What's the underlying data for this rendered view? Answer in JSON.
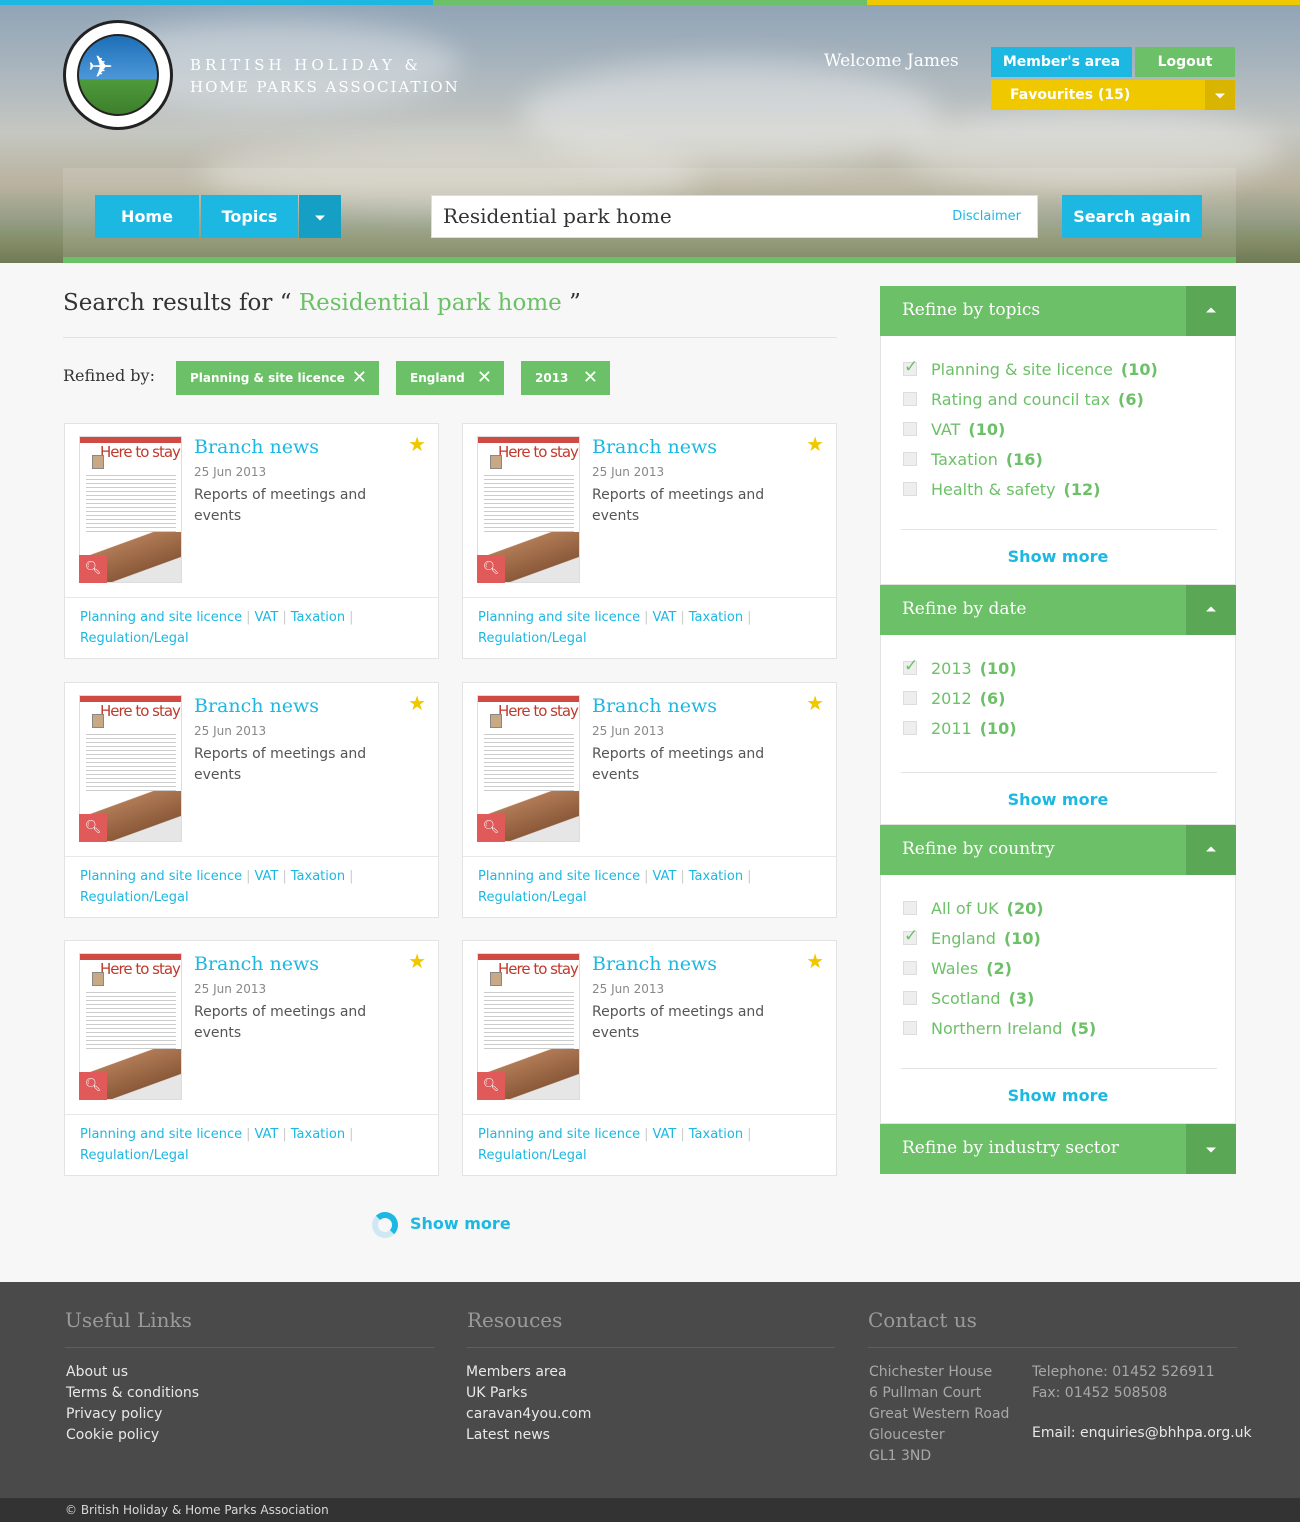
{
  "colors": {
    "blue": "#1cb8e2",
    "green": "#6cc067",
    "yellow": "#f0c800",
    "red": "#e05a5a",
    "footer": "#4a4a4a"
  },
  "header": {
    "brand_line1": "BRITISH HOLIDAY &",
    "brand_line2": "HOME PARKS ASSOCIATION",
    "logo_text": "BRITISH HOLIDAY & HOME PARKS ASSOCIATION",
    "welcome": "Welcome James",
    "members_area": "Member's area",
    "logout": "Logout",
    "favourites": "Favourites (15)"
  },
  "nav": {
    "home": "Home",
    "topics": "Topics",
    "search_value": "Residential park home",
    "disclaimer": "Disclaimer",
    "search_again": "Search again"
  },
  "results": {
    "title_prefix": "Search results for",
    "open_quote": "“",
    "query": "Residential park home",
    "close_quote": "”",
    "refined_label": "Refined by:",
    "chips": [
      "Planning & site licence",
      "England",
      "2013"
    ],
    "show_more": "Show more"
  },
  "cards": [
    {
      "title": "Branch news",
      "date": "25 Jun 2013",
      "desc": "Reports of meetings and events",
      "thumb_title": "Here to stay?",
      "tags": [
        "Planning and site licence",
        "VAT",
        "Taxation",
        "Regulation/Legal"
      ]
    },
    {
      "title": "Branch news",
      "date": "25 Jun 2013",
      "desc": "Reports of meetings and events",
      "thumb_title": "Here to stay?",
      "tags": [
        "Planning and site licence",
        "VAT",
        "Taxation",
        "Regulation/Legal"
      ]
    },
    {
      "title": "Branch news",
      "date": "25 Jun 2013",
      "desc": "Reports of meetings and events",
      "thumb_title": "Here to stay?",
      "tags": [
        "Planning and site licence",
        "VAT",
        "Taxation",
        "Regulation/Legal"
      ]
    },
    {
      "title": "Branch news",
      "date": "25 Jun 2013",
      "desc": "Reports of meetings and events",
      "thumb_title": "Here to stay?",
      "tags": [
        "Planning and site licence",
        "VAT",
        "Taxation",
        "Regulation/Legal"
      ]
    },
    {
      "title": "Branch news",
      "date": "25 Jun 2013",
      "desc": "Reports of meetings and events",
      "thumb_title": "Here to stay?",
      "tags": [
        "Planning and site licence",
        "VAT",
        "Taxation",
        "Regulation/Legal"
      ]
    },
    {
      "title": "Branch news",
      "date": "25 Jun 2013",
      "desc": "Reports of meetings and events",
      "thumb_title": "Here to stay?",
      "tags": [
        "Planning and site licence",
        "VAT",
        "Taxation",
        "Regulation/Legal"
      ]
    }
  ],
  "sidebar": {
    "topics": {
      "title": "Refine by topics",
      "options": [
        {
          "label": "Planning & site licence",
          "count": "(10)",
          "checked": true
        },
        {
          "label": "Rating and council tax",
          "count": "(6)",
          "checked": false
        },
        {
          "label": "VAT",
          "count": "(10)",
          "checked": false
        },
        {
          "label": "Taxation",
          "count": "(16)",
          "checked": false
        },
        {
          "label": "Health & safety",
          "count": "(12)",
          "checked": false
        }
      ],
      "show_more": "Show more"
    },
    "date": {
      "title": "Refine by date",
      "options": [
        {
          "label": "2013",
          "count": "(10)",
          "checked": true
        },
        {
          "label": "2012",
          "count": "(6)",
          "checked": false
        },
        {
          "label": "2011",
          "count": "(10)",
          "checked": false
        }
      ],
      "show_more": "Show more"
    },
    "country": {
      "title": "Refine by country",
      "options": [
        {
          "label": "All of UK",
          "count": "(20)",
          "checked": false
        },
        {
          "label": "England",
          "count": "(10)",
          "checked": true
        },
        {
          "label": "Wales",
          "count": "(2)",
          "checked": false
        },
        {
          "label": "Scotland",
          "count": "(3)",
          "checked": false
        },
        {
          "label": "Northern Ireland",
          "count": "(5)",
          "checked": false
        }
      ],
      "show_more": "Show more"
    },
    "industry": {
      "title": "Refine by industry sector"
    }
  },
  "footer": {
    "useful_title": "Useful Links",
    "useful_links": [
      "About us",
      "Terms & conditions",
      "Privacy policy",
      "Cookie policy"
    ],
    "resources_title": "Resouces",
    "resources_links": [
      "Members area",
      "UK Parks",
      "caravan4you.com",
      "Latest news"
    ],
    "contact_title": "Contact us",
    "address": [
      "Chichester House",
      "6 Pullman Court",
      "Great Western Road",
      "Gloucester",
      "GL1 3ND"
    ],
    "telephone": "Telephone: 01452 526911",
    "fax": "Fax: 01452 508508",
    "email": "Email: enquiries@bhhpa.org.uk",
    "copyright": "© British Holiday & Home Parks Association"
  }
}
